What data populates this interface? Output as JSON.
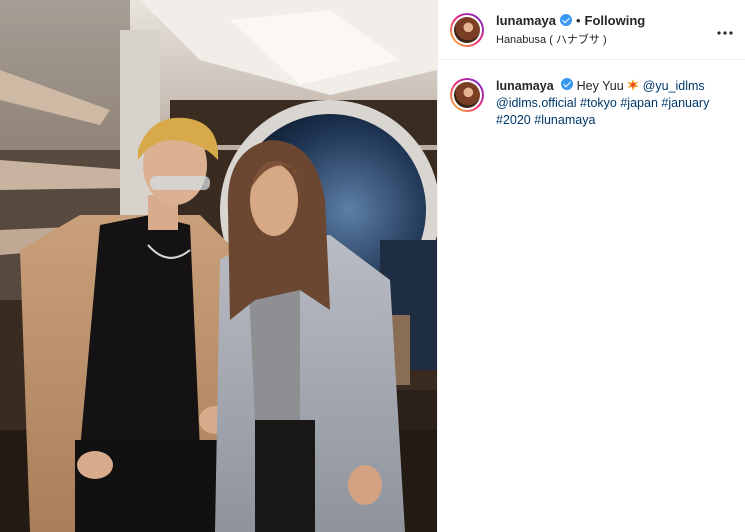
{
  "post": {
    "username": "lunamaya",
    "separator": "•",
    "follow_status": "Following",
    "location": "Hanabusa ( ハナブサ )",
    "more_icon": "more-options-icon"
  },
  "caption": {
    "username": "lunamaya",
    "text_start": "Hey Yuu",
    "emoji": "collision-emoji",
    "mention1": "@yu_idlms",
    "mention2": "@idlms.official",
    "tag1": "#tokyo",
    "tag2": "#japan",
    "tag3": "#january",
    "tag4": "#2020",
    "tag5": "#lunamaya"
  },
  "colors": {
    "verified": "#3897f0",
    "link": "#00376b",
    "text": "#262626"
  }
}
